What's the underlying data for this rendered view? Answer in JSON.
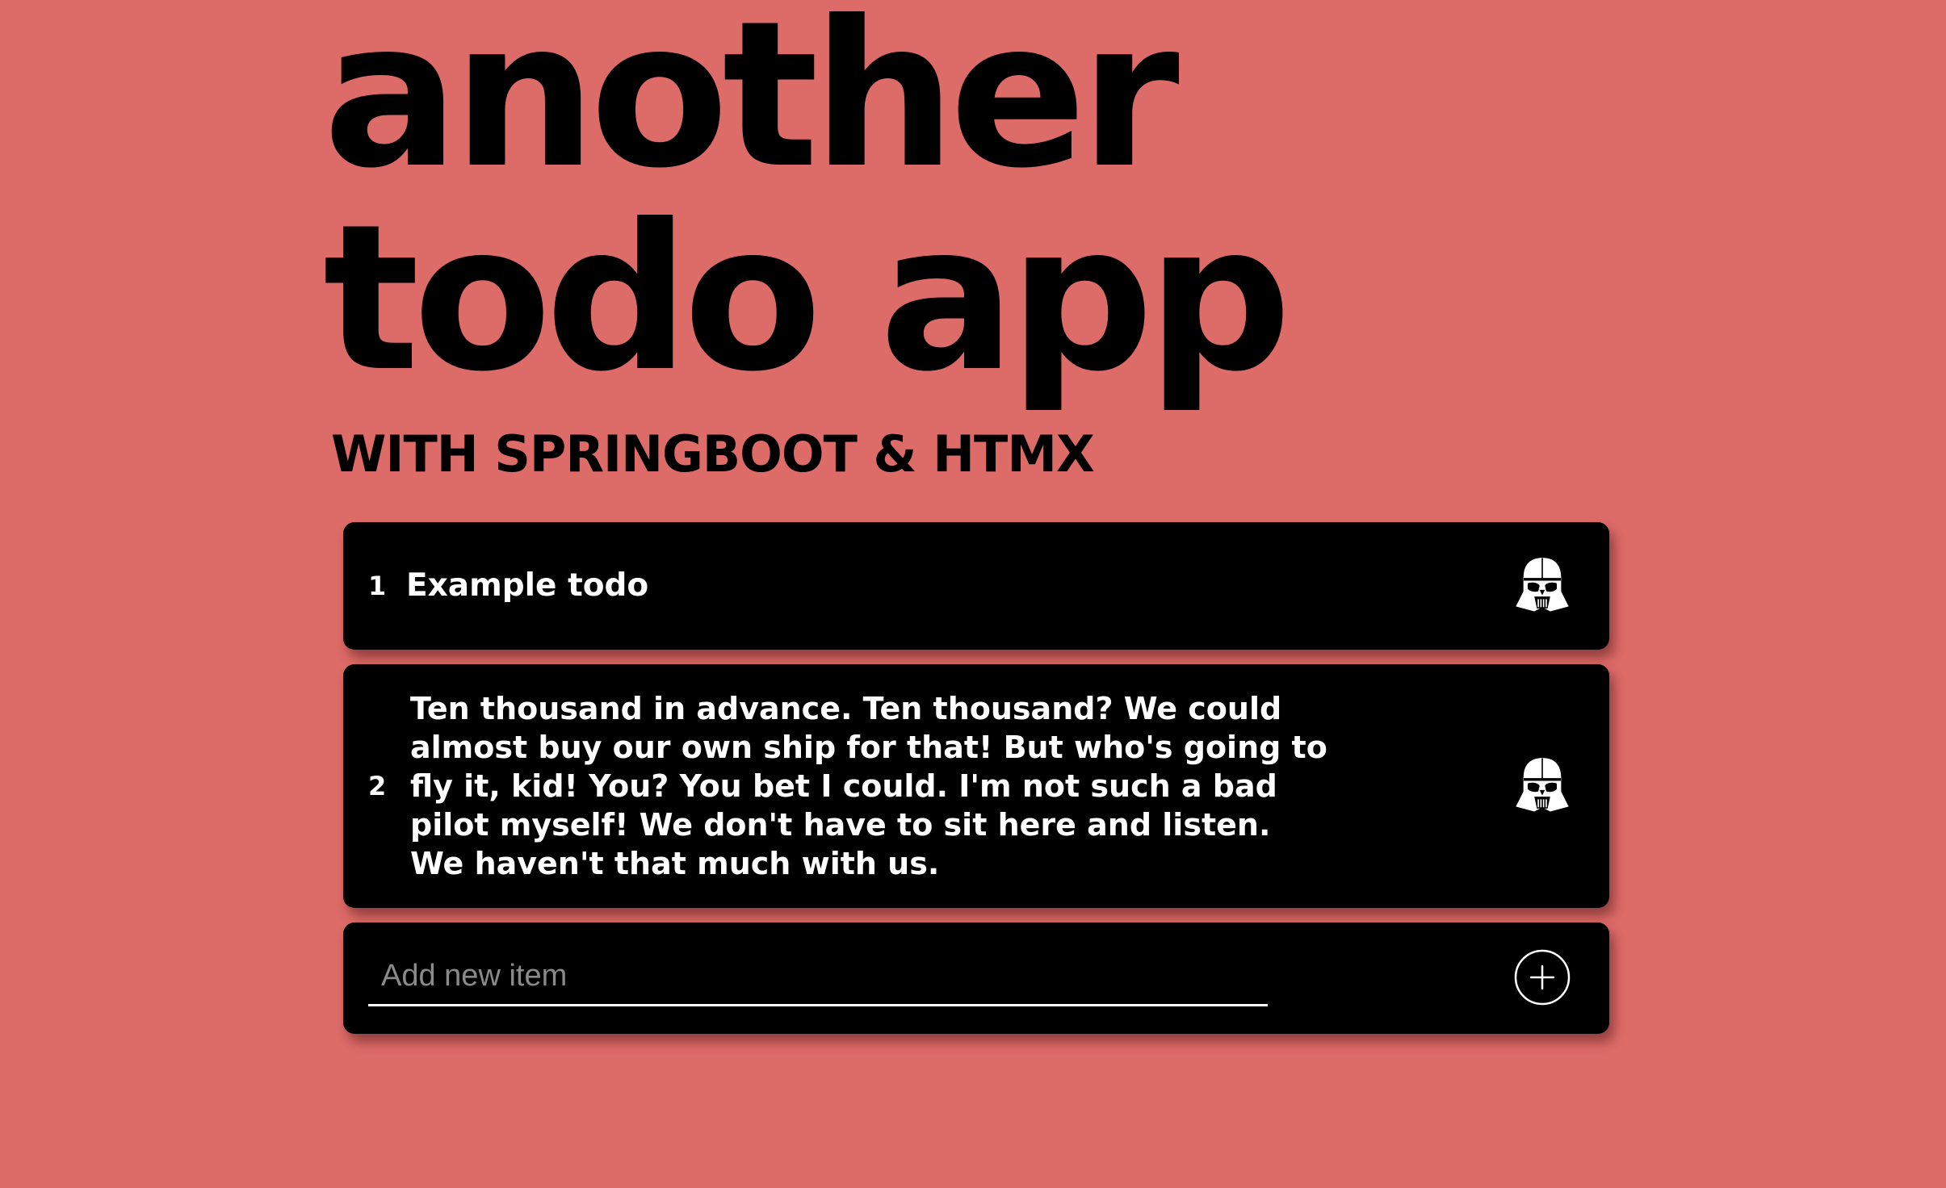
{
  "header": {
    "title_line_1": "another",
    "title_line_2": "todo app",
    "subtitle": "WITH SPRINGBOOT & HTMX"
  },
  "todos": [
    {
      "index": "1",
      "text": "Example todo",
      "action_icon": "darth-vader-helmet-icon"
    },
    {
      "index": "2",
      "text": "Ten thousand in advance. Ten thousand? We could almost buy our own ship for that! But who's going to fly it, kid! You? You bet I could. I'm not such a bad pilot myself! We don't have to sit here and listen. We haven't that much with us.",
      "action_icon": "darth-vader-helmet-icon"
    }
  ],
  "add_form": {
    "placeholder": "Add new item",
    "value": "",
    "button_icon": "plus-circle-icon"
  },
  "colors": {
    "background": "#dd6b68",
    "card": "#000000",
    "text": "#ffffff"
  }
}
